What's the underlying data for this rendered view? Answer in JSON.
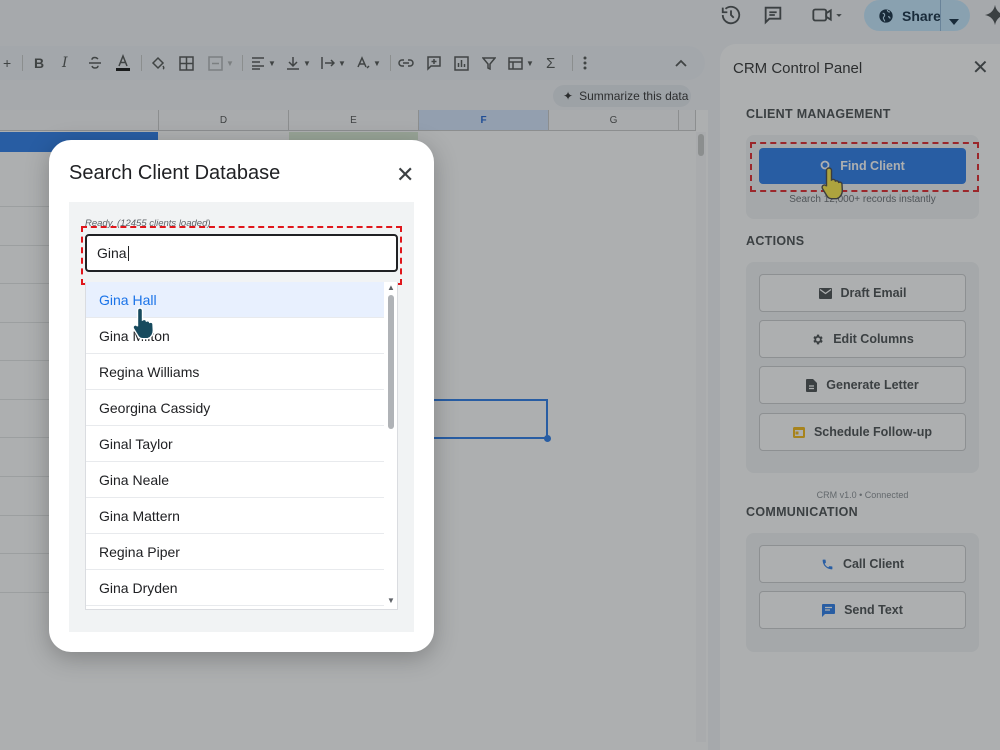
{
  "topbar": {
    "icons": [
      "history-icon",
      "comment-icon",
      "video-icon",
      "globe-icon",
      "gemini-star-icon"
    ],
    "share_label": "Share"
  },
  "toolbar": {
    "icons": [
      "plus-icon",
      "bold-icon",
      "italic-icon",
      "strikethrough-icon",
      "text-color-icon",
      "fill-color-icon",
      "borders-icon",
      "merge-icon",
      "align-icon",
      "valign-icon",
      "wrap-icon",
      "rotate-icon",
      "link-icon",
      "comment-add-icon",
      "chart-icon",
      "filter-icon",
      "table-icon",
      "functions-icon",
      "more-icon",
      "collapse-icon"
    ],
    "bold": "B",
    "italic": "I",
    "sigma": "Σ"
  },
  "summarize": {
    "label": "Summarize this data"
  },
  "grid": {
    "columns": [
      "D",
      "E",
      "F",
      "G"
    ],
    "selected_column": "F"
  },
  "panel": {
    "title": "CRM Control Panel",
    "sections": {
      "client_management": "CLIENT MANAGEMENT",
      "actions": "ACTIONS",
      "communication": "COMMUNICATION"
    },
    "find_client": {
      "label": "Find Client",
      "hint": "Search 12,000+ records instantly"
    },
    "actions": [
      {
        "label": "Draft Email",
        "icon": "mail-icon"
      },
      {
        "label": "Edit Columns",
        "icon": "gear-icon"
      },
      {
        "label": "Generate Letter",
        "icon": "document-icon"
      },
      {
        "label": "Schedule Follow-up",
        "icon": "calendar-icon"
      }
    ],
    "version": "CRM v1.0 • Connected",
    "communication": [
      {
        "label": "Call Client",
        "icon": "phone-icon"
      },
      {
        "label": "Send Text",
        "icon": "chat-icon"
      }
    ]
  },
  "modal": {
    "title": "Search Client Database",
    "status": "Ready. (12455 clients loaded)",
    "search_value": "Gina",
    "results": [
      "Gina Hall",
      "Gina Milton",
      "Regina Williams",
      "Georgina Cassidy",
      "Ginal Taylor",
      "Gina Neale",
      "Gina Mattern",
      "Regina Piper",
      "Gina Dryden"
    ],
    "highlighted_index": 0
  },
  "colors": {
    "accent": "#1a73e8",
    "share_bg": "#c2e7ff",
    "highlight_dash": "#e0161b",
    "calendar_icon": "#f4b400"
  }
}
